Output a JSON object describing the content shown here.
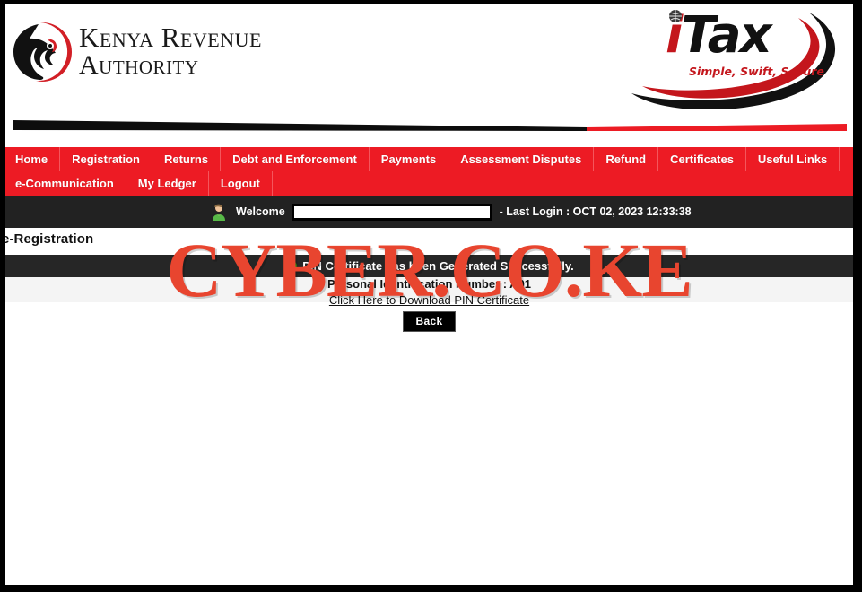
{
  "brand": {
    "kra_line1": "Kenya Revenue",
    "kra_line2": "Authority",
    "itax_i": "i",
    "itax_tax": "Tax",
    "itax_tagline": "Simple, Swift, Secure",
    "nav_red": "#ED1B24",
    "watermark_red": "#E8452F",
    "success_green": "#4CAE18"
  },
  "nav": {
    "row1": [
      {
        "label": "Home"
      },
      {
        "label": "Registration"
      },
      {
        "label": "Returns"
      },
      {
        "label": "Debt and Enforcement"
      },
      {
        "label": "Payments"
      },
      {
        "label": "Assessment Disputes"
      },
      {
        "label": "Refund"
      },
      {
        "label": "Certificates"
      },
      {
        "label": "Useful Links"
      }
    ],
    "row2": [
      {
        "label": "e-Communication"
      },
      {
        "label": "My Ledger"
      },
      {
        "label": "Logout"
      }
    ]
  },
  "userbar": {
    "avatar_icon": "user-avatar-icon",
    "welcome_label": "Welcome",
    "username_value": "",
    "last_login": "- Last Login : OCT 02, 2023 12:33:38"
  },
  "content": {
    "page_title": "e-Registration",
    "success_icon": "green-check-icon",
    "success_message": "PIN Certificate has been Generated Successfully.",
    "pin_line": "Personal Identification Number : A01",
    "download_prefix": "",
    "download_link": "Click Here to Download PIN Certificate",
    "back_label": "Back"
  },
  "overlay": {
    "watermark_text": "CYBER.CO.KE"
  }
}
